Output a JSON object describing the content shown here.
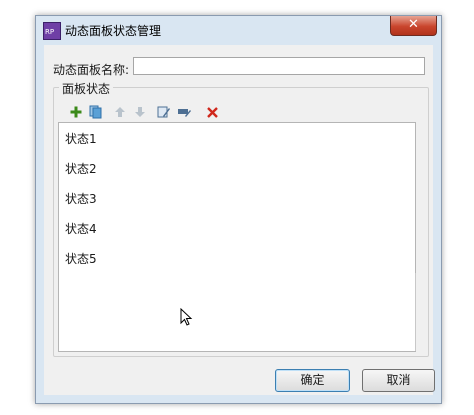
{
  "window": {
    "title": "动态面板状态管理",
    "app_icon": "RP",
    "close_glyph": "✕"
  },
  "form": {
    "name_label": "动态面板名称:",
    "name_value": "",
    "group_label": "面板状态"
  },
  "toolbar": {
    "icons": [
      "add-icon",
      "duplicate-icon",
      "move-up-icon",
      "move-down-icon",
      "edit-state-icon",
      "edit-all-icon",
      "delete-icon"
    ],
    "colors": {
      "add": "#3b8a1a",
      "delete": "#d0281c",
      "disabled": "#b9c3cc"
    }
  },
  "states": [
    {
      "label": "状态1"
    },
    {
      "label": "状态2"
    },
    {
      "label": "状态3"
    },
    {
      "label": "状态4"
    },
    {
      "label": "状态5"
    }
  ],
  "buttons": {
    "ok": "确定",
    "cancel": "取消"
  }
}
